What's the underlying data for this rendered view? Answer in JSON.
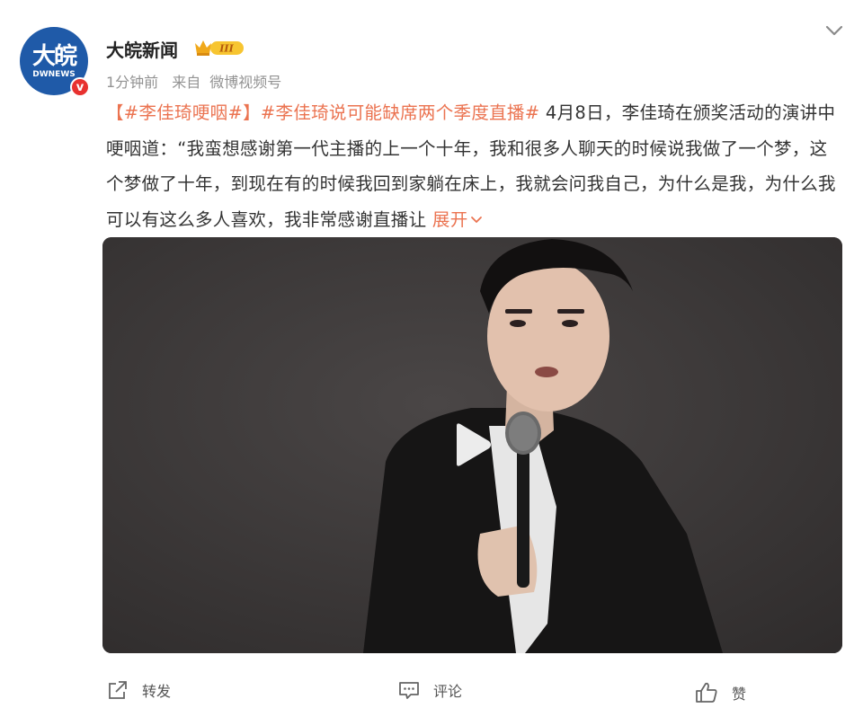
{
  "author": {
    "name": "大皖新闻",
    "avatar_text": "大皖",
    "avatar_subtext": "DWNEWS",
    "verified_mark": "v",
    "level_badge": "III"
  },
  "meta": {
    "time": "1分钟前",
    "source_prefix": "来自",
    "source": "微博视频号"
  },
  "post": {
    "tag1": "【#李佳琦哽咽#】",
    "tag2": "#李佳琦说可能缺席两个季度直播#",
    "body": " 4月8日，李佳琦在颁奖活动的演讲中哽咽道：“我蛮想感谢第一代主播的上一个十年，我和很多人聊天的时候说我做了一个梦，这个梦做了十年，到现在有的时候我回到家躺在床上，我就会问我自己，为什么是我，为什么我可以有这么多人喜欢，我非常感谢直播让",
    "expand": "展开"
  },
  "actions": {
    "repost": "转发",
    "comment": "评论",
    "like": "赞"
  },
  "colors": {
    "accent": "#eb7350",
    "avatar_bg": "#1f5aa8",
    "verified": "#e8312f",
    "meta_text": "#939393"
  },
  "icons": {
    "more": "chevron-down-icon",
    "play": "play-icon",
    "repost": "repost-icon",
    "comment": "comment-icon",
    "like": "thumbs-up-icon"
  }
}
